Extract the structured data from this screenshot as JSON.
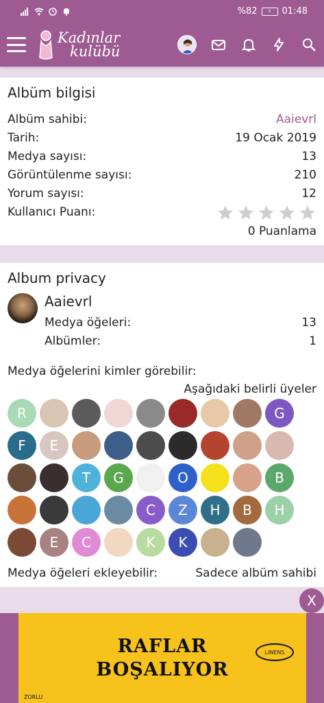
{
  "status": {
    "battery": "%82",
    "time": "01:48"
  },
  "header": {
    "logo_line1": "Kadınlar",
    "logo_line2": "kulübü"
  },
  "album_info": {
    "title": "Albüm bilgisi",
    "rows": [
      {
        "label": "Albüm sahibi:",
        "value": "Aaievrl",
        "link": true
      },
      {
        "label": "Tarih:",
        "value": "19 Ocak 2019"
      },
      {
        "label": "Medya sayısı:",
        "value": "13"
      },
      {
        "label": "Görüntülenme sayısı:",
        "value": "210"
      },
      {
        "label": "Yorum sayısı:",
        "value": "12"
      }
    ],
    "rating_label": "Kullanıcı Puanı:",
    "rating_value": 0,
    "ratings_count": "0 Puanlama"
  },
  "privacy": {
    "title": "Album privacy",
    "owner_name": "Aaievrl",
    "media_label": "Medya öğeleri:",
    "media_value": "13",
    "albums_label": "Albümler:",
    "albums_value": "1",
    "who_label": "Medya öğelerini kimler görebilir:",
    "who_value": "Aşağıdaki belirli üyeler",
    "add_label": "Medya öğeleri ekleyebilir:",
    "add_value": "Sadece albüm sahibi",
    "members": [
      {
        "letter": "R",
        "color": "#a8dbb5"
      },
      {
        "letter": "",
        "color": "#d9c6b2"
      },
      {
        "letter": "",
        "color": "#5b5b5b"
      },
      {
        "letter": "",
        "color": "#f1d6d6"
      },
      {
        "letter": "",
        "color": "#8a8a8a"
      },
      {
        "letter": "",
        "color": "#9a2a2a"
      },
      {
        "letter": "",
        "color": "#e7c9a7"
      },
      {
        "letter": "",
        "color": "#a07864"
      },
      {
        "letter": "G",
        "color": "#7e57c2"
      },
      {
        "letter": "F",
        "color": "#2a6c8c"
      },
      {
        "letter": "E",
        "color": "#d8c6c1"
      },
      {
        "letter": "",
        "color": "#c79b7c"
      },
      {
        "letter": "",
        "color": "#3e5e8a"
      },
      {
        "letter": "",
        "color": "#4c4c4c"
      },
      {
        "letter": "",
        "color": "#2b2b2b"
      },
      {
        "letter": "",
        "color": "#b3452e"
      },
      {
        "letter": "",
        "color": "#cfa08a"
      },
      {
        "letter": "",
        "color": "#d9b8b0"
      },
      {
        "letter": "",
        "color": "#6a4d3b"
      },
      {
        "letter": "",
        "color": "#3a2e2e"
      },
      {
        "letter": "T",
        "color": "#4fb3d9"
      },
      {
        "letter": "G",
        "color": "#5aa84d"
      },
      {
        "letter": "",
        "color": "#f0f0f0"
      },
      {
        "letter": "O",
        "color": "#2d60c9"
      },
      {
        "letter": "",
        "color": "#f5e11b"
      },
      {
        "letter": "",
        "color": "#d7a289"
      },
      {
        "letter": "B",
        "color": "#5aa86a"
      },
      {
        "letter": "",
        "color": "#c8733a"
      },
      {
        "letter": "",
        "color": "#3a3a3a"
      },
      {
        "letter": "",
        "color": "#4aa6d6"
      },
      {
        "letter": "",
        "color": "#6b8aa3"
      },
      {
        "letter": "C",
        "color": "#8a5cc9"
      },
      {
        "letter": "Z",
        "color": "#5b88d6"
      },
      {
        "letter": "H",
        "color": "#2f6f8a"
      },
      {
        "letter": "B",
        "color": "#a36b3d"
      },
      {
        "letter": "H",
        "color": "#9bd1a8"
      },
      {
        "letter": "",
        "color": "#7a4a34"
      },
      {
        "letter": "E",
        "color": "#a88181"
      },
      {
        "letter": "C",
        "color": "#e08ad6"
      },
      {
        "letter": "",
        "color": "#f1d8c0"
      },
      {
        "letter": "K",
        "color": "#b7dba0"
      },
      {
        "letter": "K",
        "color": "#3b4db3"
      },
      {
        "letter": "",
        "color": "#c9b08e"
      },
      {
        "letter": "",
        "color": "#6e7a8c"
      }
    ]
  },
  "ad": {
    "title_line1": "RAFLAR",
    "title_line2": "BOŞALIYOR",
    "brand_logo": "LINENS",
    "footer": "ZORLU",
    "close": "X"
  },
  "colors": {
    "brand": "#9d5b92",
    "background": "#e9dbe9",
    "star": "#d0cccf"
  }
}
